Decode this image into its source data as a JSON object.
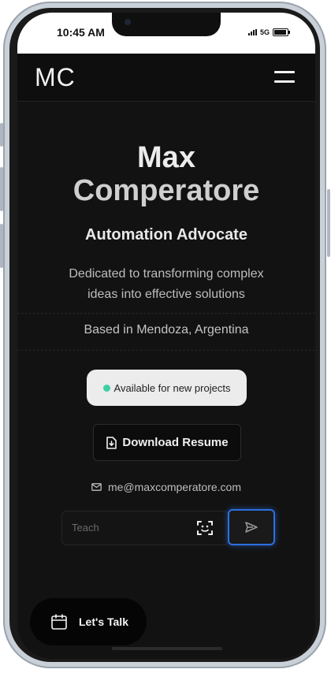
{
  "status": {
    "time": "10:45 AM",
    "network": "5G"
  },
  "header": {
    "logo": "MC",
    "menu_icon": "hamburger-menu-icon"
  },
  "hero": {
    "name_line1": "Max",
    "name_line2": "Comperatore",
    "role": "Automation Advocate",
    "tagline_line1": "Dedicated to transforming complex",
    "tagline_line2": "ideas into effective solutions",
    "location": "Based in Mendoza, Argentina"
  },
  "availability": {
    "label": "Available for new projects",
    "dot_color": "#3fcfa5"
  },
  "resume": {
    "label": "Download Resume",
    "icon": "file-download-icon"
  },
  "contact": {
    "email": "me@maxcomperatore.com",
    "icon": "mail-icon"
  },
  "chat": {
    "placeholder": "Teach",
    "value": "",
    "scan_icon": "face-scan-icon",
    "send_icon": "send-icon",
    "accent": "#2d6fe0"
  },
  "cta": {
    "label": "Let's Talk",
    "icon": "calendar-icon"
  }
}
